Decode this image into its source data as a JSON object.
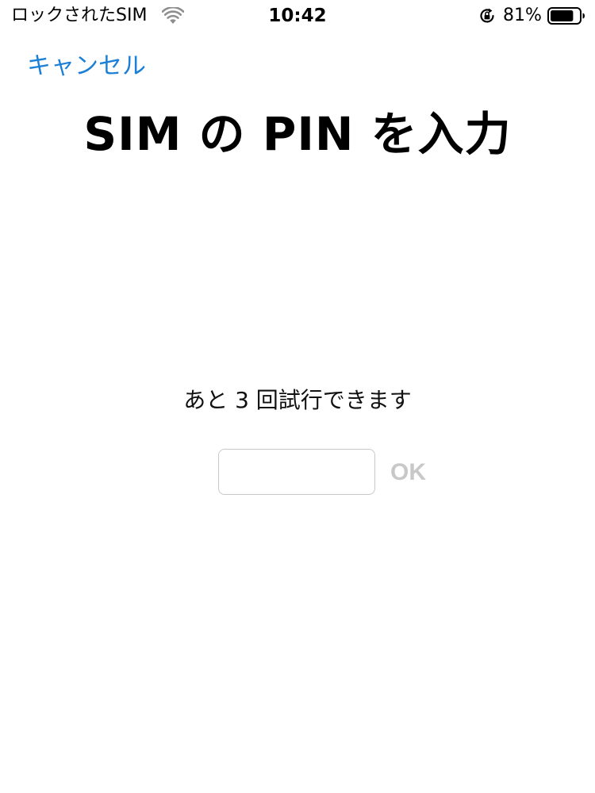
{
  "status_bar": {
    "carrier": "ロックされたSIM",
    "time": "10:42",
    "battery_percent": "81%",
    "battery_level": 0.81,
    "icons": [
      "wifi-icon",
      "lock-rotation-icon",
      "battery-icon"
    ]
  },
  "nav": {
    "cancel_label": "キャンセル"
  },
  "title": "SIM の PIN を入力",
  "attempts_message": "あと 3 回試行できます",
  "pin_field": {
    "value": "",
    "placeholder": ""
  },
  "ok_label": "OK",
  "colors": {
    "accent": "#1a7fd6",
    "disabled": "#c8c8c8",
    "field_border": "#c9c9c9"
  }
}
